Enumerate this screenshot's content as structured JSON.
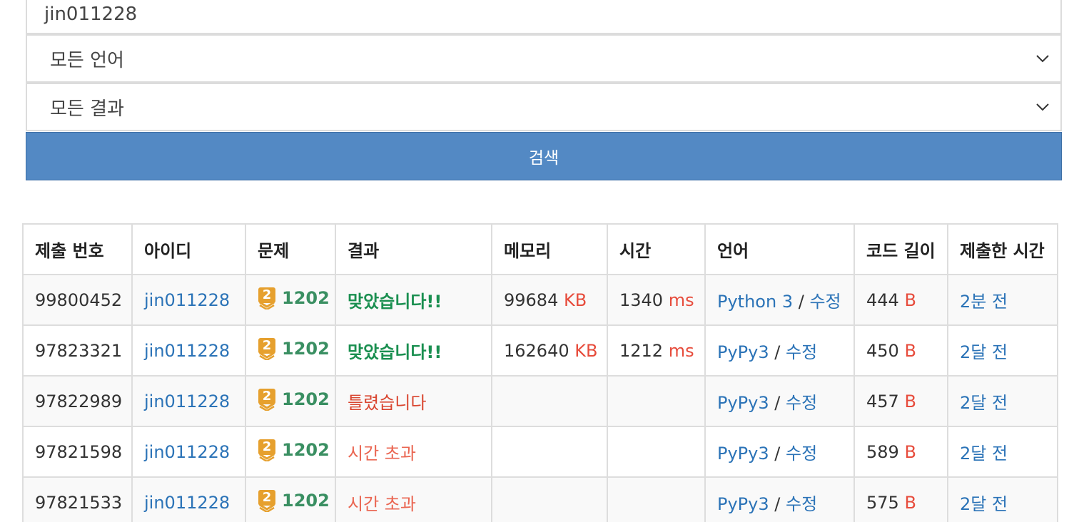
{
  "search_form": {
    "user_id_value": "jin011228",
    "language_select": "모든 언어",
    "result_select": "모든 결과",
    "search_button": "검색"
  },
  "table": {
    "headers": [
      "제출 번호",
      "아이디",
      "문제",
      "결과",
      "메모리",
      "시간",
      "언어",
      "코드 길이",
      "제출한 시간"
    ],
    "rows": [
      {
        "id": "99800452",
        "user": "jin011228",
        "tier": "2",
        "problem": "1202",
        "result": "맞았습니다!!",
        "result_type": "accepted",
        "memory": "99684",
        "memory_unit": "KB",
        "time": "1340",
        "time_unit": "ms",
        "language": "Python 3",
        "sep": "/",
        "edit": "수정",
        "code_length": "444",
        "length_unit": "B",
        "submitted": "2분 전"
      },
      {
        "id": "97823321",
        "user": "jin011228",
        "tier": "2",
        "problem": "1202",
        "result": "맞았습니다!!",
        "result_type": "accepted",
        "memory": "162640",
        "memory_unit": "KB",
        "time": "1212",
        "time_unit": "ms",
        "language": "PyPy3",
        "sep": "/",
        "edit": "수정",
        "code_length": "450",
        "length_unit": "B",
        "submitted": "2달 전"
      },
      {
        "id": "97822989",
        "user": "jin011228",
        "tier": "2",
        "problem": "1202",
        "result": "틀렸습니다",
        "result_type": "wrong",
        "memory": "",
        "memory_unit": "",
        "time": "",
        "time_unit": "",
        "language": "PyPy3",
        "sep": "/",
        "edit": "수정",
        "code_length": "457",
        "length_unit": "B",
        "submitted": "2달 전"
      },
      {
        "id": "97821598",
        "user": "jin011228",
        "tier": "2",
        "problem": "1202",
        "result": "시간 초과",
        "result_type": "tle",
        "memory": "",
        "memory_unit": "",
        "time": "",
        "time_unit": "",
        "language": "PyPy3",
        "sep": "/",
        "edit": "수정",
        "code_length": "589",
        "length_unit": "B",
        "submitted": "2달 전"
      },
      {
        "id": "97821533",
        "user": "jin011228",
        "tier": "2",
        "problem": "1202",
        "result": "시간 초과",
        "result_type": "tle",
        "memory": "",
        "memory_unit": "",
        "time": "",
        "time_unit": "",
        "language": "PyPy3",
        "sep": "/",
        "edit": "수정",
        "code_length": "575",
        "length_unit": "B",
        "submitted": "2달 전"
      }
    ]
  },
  "colors": {
    "button_blue": "#5389c4",
    "link_blue": "#2b73b7",
    "unit_red": "#e74c3c",
    "accepted_green": "#1a8f50",
    "wrong_red": "#d9452f",
    "tle_red": "#ea6652",
    "tier_gold": "#e6a02e"
  }
}
